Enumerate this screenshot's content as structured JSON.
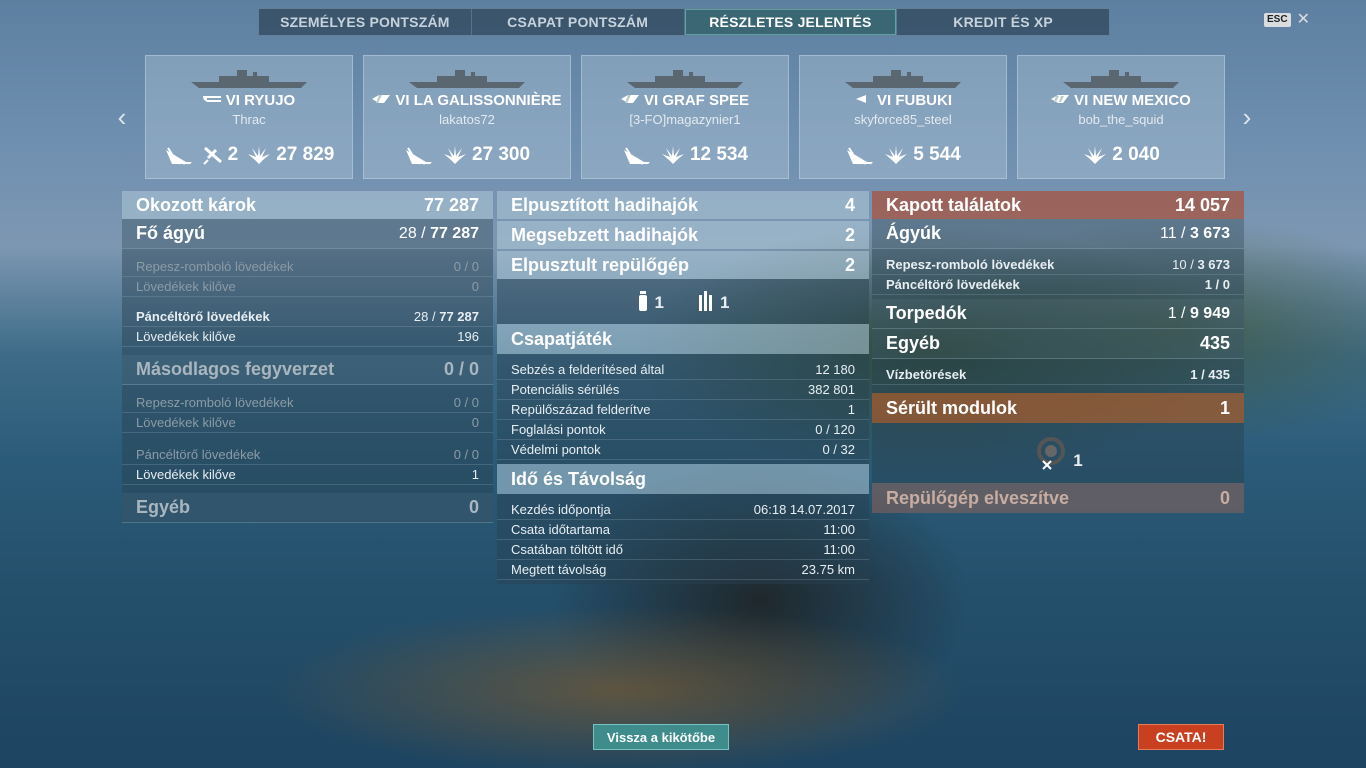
{
  "tabs": [
    {
      "label": "SZEMÉLYES PONTSZÁM",
      "active": false
    },
    {
      "label": "CSAPAT PONTSZÁM",
      "active": false
    },
    {
      "label": "RÉSZLETES JELENTÉS",
      "active": true
    },
    {
      "label": "KREDIT ÉS XP",
      "active": false
    }
  ],
  "esc_label": "ESC",
  "close_glyph": "✕",
  "nav": {
    "prev": "‹",
    "next": "›"
  },
  "cards": [
    {
      "name": "VI RYUJO",
      "player": "Thrac",
      "class_icon": "carrier-icon",
      "sunk_icon": true,
      "planes": "2",
      "damage": "27 829"
    },
    {
      "name": "VI LA GALISSONNIÈRE",
      "player": "lakatos72",
      "class_icon": "cruiser-icon",
      "sunk_icon": true,
      "planes": "",
      "damage": "27 300"
    },
    {
      "name": "VI GRAF SPEE",
      "player": "[3-FO]magazynier1",
      "class_icon": "cruiser-icon",
      "sunk_icon": true,
      "planes": "",
      "damage": "12 534"
    },
    {
      "name": "VI FUBUKI",
      "player": "skyforce85_steel",
      "class_icon": "destroyer-icon",
      "sunk_icon": true,
      "planes": "",
      "damage": "5 544"
    },
    {
      "name": "VI NEW MEXICO",
      "player": "bob_the_squid",
      "class_icon": "battleship-icon",
      "sunk_icon": false,
      "planes": "",
      "damage": "2 040"
    }
  ],
  "left": {
    "header": {
      "label": "Okozott károk",
      "value": "77 287"
    },
    "main_guns": {
      "label": "Fő ágyú",
      "hits": "28",
      "total": "77 287"
    },
    "he": {
      "label": "Repesz-romboló lövedékek",
      "value": "0 / 0"
    },
    "he_fired": {
      "label": "Lövedékek kilőve",
      "value": "0"
    },
    "ap": {
      "label": "Páncéltörő lövedékek",
      "hits": "28",
      "total": "77 287"
    },
    "ap_fired": {
      "label": "Lövedékek kilőve",
      "value": "196"
    },
    "secondary": {
      "label": "Másodlagos fegyverzet",
      "value": "0 / 0"
    },
    "sec_he": {
      "label": "Repesz-romboló lövedékek",
      "value": "0 / 0"
    },
    "sec_he_fired": {
      "label": "Lövedékek kilőve",
      "value": "0"
    },
    "sec_ap": {
      "label": "Páncéltörő lövedékek",
      "value": "0 / 0"
    },
    "sec_ap_fired": {
      "label": "Lövedékek kilőve",
      "value": "1"
    },
    "other": {
      "label": "Egyéb",
      "value": "0"
    }
  },
  "middle": {
    "destroyed": {
      "label": "Elpusztított hadihajók",
      "value": "4"
    },
    "damaged": {
      "label": "Megsebzett hadihajók",
      "value": "2"
    },
    "planes": {
      "label": "Elpusztult repülőgép",
      "value": "2"
    },
    "ribbons": [
      {
        "icon": "torpedo-bomber-icon",
        "count": "1"
      },
      {
        "icon": "dive-bomber-icon",
        "count": "1"
      }
    ],
    "teamplay": {
      "title": "Csapatjáték",
      "rows": [
        {
          "label": "Sebzés a felderítésed által",
          "value": "12 180"
        },
        {
          "label": "Potenciális sérülés",
          "value": "382 801"
        },
        {
          "label": "Repülőszázad felderítve",
          "value": "1"
        },
        {
          "label": "Foglalási pontok",
          "value": "0 / 120"
        },
        {
          "label": "Védelmi pontok",
          "value": "0 / 32"
        }
      ]
    },
    "time": {
      "title": "Idő és Távolság",
      "rows": [
        {
          "label": "Kezdés időpontja",
          "value": "06:18  14.07.2017"
        },
        {
          "label": "Csata időtartama",
          "value": "11:00"
        },
        {
          "label": "Csatában töltött idő",
          "value": "11:00"
        },
        {
          "label": "Megtett távolság",
          "value": "23.75 km"
        }
      ]
    }
  },
  "right": {
    "received": {
      "label": "Kapott találatok",
      "value": "14 057"
    },
    "guns": {
      "label": "Ágyúk",
      "hits": "11",
      "total": "3 673"
    },
    "he": {
      "label": "Repesz-romboló lövedékek",
      "hits": "10",
      "total": "3 673"
    },
    "ap": {
      "label": "Páncéltörő lövedékek",
      "value": "1 / 0"
    },
    "torpedoes": {
      "label": "Torpedók",
      "hits": "1",
      "total": "9 949"
    },
    "other": {
      "label": "Egyéb",
      "value": "435"
    },
    "flooding": {
      "label": "Vízbetörések",
      "value": "1 / 435"
    },
    "modules": {
      "label": "Sérült modulok",
      "value": "1",
      "icon": "steering-gear-icon",
      "count": "1"
    },
    "planes_lost": {
      "label": "Repülőgép elveszítve",
      "value": "0"
    }
  },
  "buttons": {
    "back": "Vissza a kikötőbe",
    "battle": "CSATA!"
  },
  "colors": {
    "accent_teal": "#3f8c8c",
    "battle_red": "#c8401f",
    "received_header": "#aa5037"
  }
}
